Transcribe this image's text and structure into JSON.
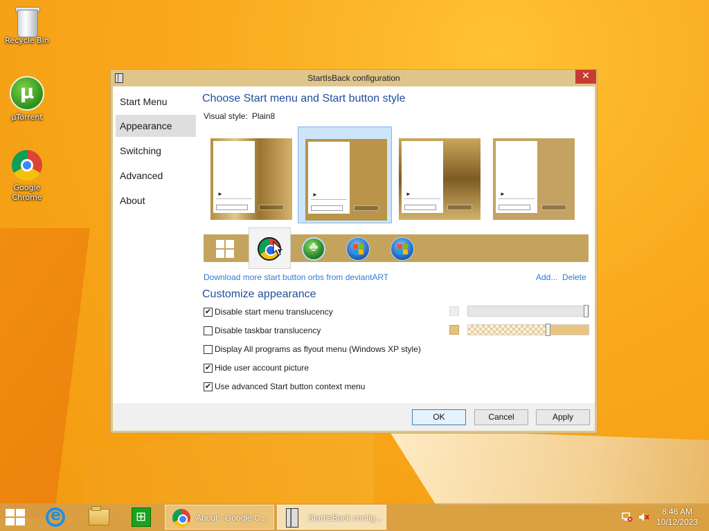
{
  "desktop": {
    "icons": [
      {
        "label": "Recycle Bin"
      },
      {
        "label": "µTorrent"
      },
      {
        "label": "Google Chrome"
      }
    ]
  },
  "dialog": {
    "title": "StartIsBack configuration",
    "close_glyph": "✕",
    "nav": [
      {
        "label": "Start Menu"
      },
      {
        "label": "Appearance"
      },
      {
        "label": "Switching"
      },
      {
        "label": "Advanced"
      },
      {
        "label": "About"
      }
    ],
    "active_nav": "Appearance",
    "heading_style": "Choose Start menu and Start button style",
    "visual_style_label": "Visual style:",
    "visual_style_value": "Plain8",
    "selected_style_index": 1,
    "orbs": [
      {
        "name": "windows8-orb"
      },
      {
        "name": "chrome-orb"
      },
      {
        "name": "clover-orb"
      },
      {
        "name": "windows7-orb"
      },
      {
        "name": "windows7-orb-alt"
      }
    ],
    "selected_orb_index": 1,
    "download_link": "Download more start button orbs from deviantART",
    "add_link": "Add...",
    "delete_link": "Delete",
    "heading_customize": "Customize appearance",
    "checkboxes": [
      {
        "label": "Disable start menu translucency",
        "checked": true
      },
      {
        "label": "Disable taskbar translucency",
        "checked": false
      },
      {
        "label": "Display All programs as flyout menu (Windows XP style)",
        "checked": false
      },
      {
        "label": "Hide user account picture",
        "checked": true
      },
      {
        "label": "Use advanced Start button context menu",
        "checked": true
      }
    ],
    "check_glyph": "✔",
    "start_menu_color": "#eeeeee",
    "taskbar_color": "#e6c27a",
    "start_menu_translucency": 1.0,
    "taskbar_translucency": 0.66,
    "buttons": {
      "ok": "OK",
      "cancel": "Cancel",
      "apply": "Apply"
    }
  },
  "taskbar": {
    "tasks": [
      {
        "label": "About - Google C..."
      },
      {
        "label": "StartIsBack config..."
      }
    ],
    "clock_time": "8:46 AM",
    "clock_date": "10/12/2023"
  }
}
